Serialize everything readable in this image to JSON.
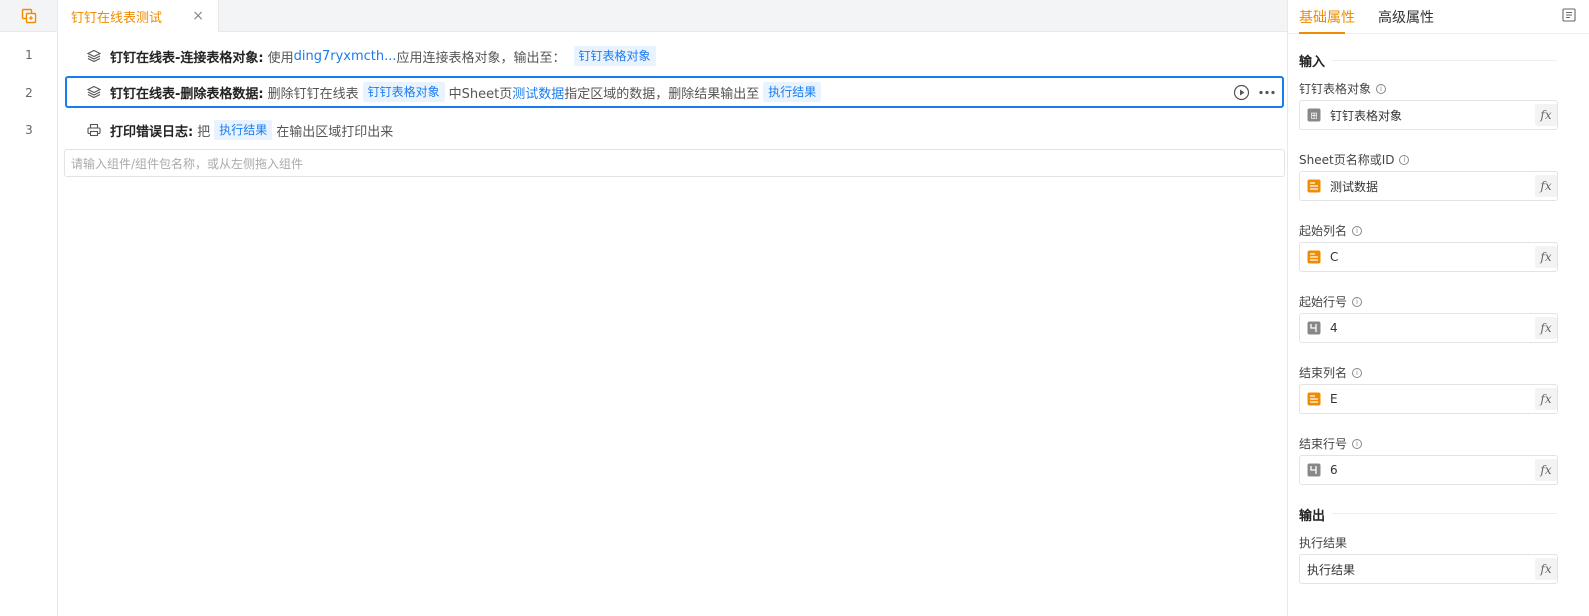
{
  "tab": {
    "title": "钉钉在线表测试",
    "close": "×"
  },
  "lines": [
    "1",
    "2",
    "3"
  ],
  "rows": [
    {
      "title": "钉钉在线表-连接表格对象:",
      "t1": "使用",
      "link": "ding7ryxmcth...",
      "t2": "应用连接表格对象，输出至：",
      "tag1": "钉钉表格对象"
    },
    {
      "title": "钉钉在线表-删除表格数据:",
      "t1": "删除钉钉在线表",
      "tag1": "钉钉表格对象",
      "t2": "中Sheet页",
      "link": "测试数据",
      "t3": "指定区域的数据，删除结果输出至",
      "tag2": "执行结果"
    },
    {
      "title": "打印错误日志:",
      "t1": "把",
      "tag1": "执行结果",
      "t2": "在输出区域打印出来"
    }
  ],
  "search": {
    "placeholder": "请输入组件/组件包名称，或从左侧拖入组件"
  },
  "panel": {
    "tab_basic": "基础属性",
    "tab_advanced": "高级属性",
    "input_title": "输入",
    "output_title": "输出",
    "fields": [
      {
        "label": "钉钉表格对象",
        "value": "钉钉表格对象",
        "type": "object"
      },
      {
        "label": "Sheet页名称或ID",
        "value": "测试数据",
        "type": "text"
      },
      {
        "label": "起始列名",
        "value": "C",
        "type": "text"
      },
      {
        "label": "起始行号",
        "value": "4",
        "type": "number"
      },
      {
        "label": "结束列名",
        "value": "E",
        "type": "text"
      },
      {
        "label": "结束行号",
        "value": "6",
        "type": "number"
      }
    ],
    "output_field": {
      "label": "执行结果",
      "value": "执行结果"
    },
    "fx_label": "fx",
    "info_mark": "i"
  },
  "colors": {
    "accent": "#f08c00",
    "link": "#1a7cf0",
    "tag_bg": "#e8f3ff"
  }
}
